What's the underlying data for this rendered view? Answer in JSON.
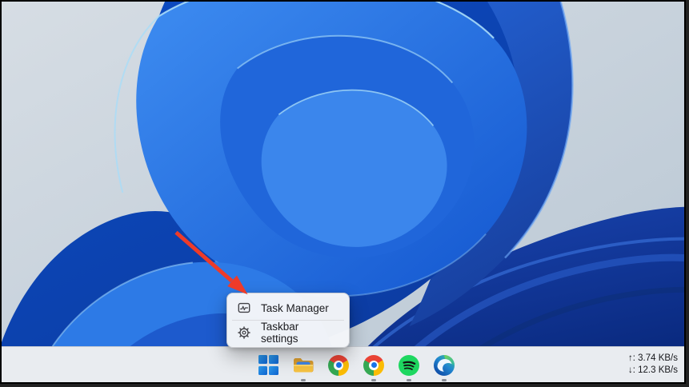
{
  "context_menu": {
    "items": [
      {
        "label": "Task Manager",
        "icon": "task-manager-icon"
      },
      {
        "label": "Taskbar settings",
        "icon": "gear-icon"
      }
    ]
  },
  "taskbar": {
    "icons": [
      {
        "name": "start",
        "running": false
      },
      {
        "name": "file-explorer",
        "running": true
      },
      {
        "name": "chrome",
        "running": false
      },
      {
        "name": "chrome-2",
        "running": true
      },
      {
        "name": "spotify",
        "running": true
      },
      {
        "name": "edge",
        "running": true
      }
    ],
    "tray": {
      "upload": "↑: 3.74 KB/s",
      "download": "↓: 12.3 KB/s"
    }
  },
  "annotation": {
    "type": "arrow",
    "color": "#ee3b29",
    "points_to": "Task Manager"
  },
  "colors": {
    "taskbar_bg": "#e9ecf0",
    "menu_bg": "#f3f5f8",
    "wallpaper_bright_blue": "#2e7ee9",
    "wallpaper_deep_blue": "#0b45bb",
    "wallpaper_navy": "#0d2f8f",
    "background_gray": "#c7d2dc"
  }
}
